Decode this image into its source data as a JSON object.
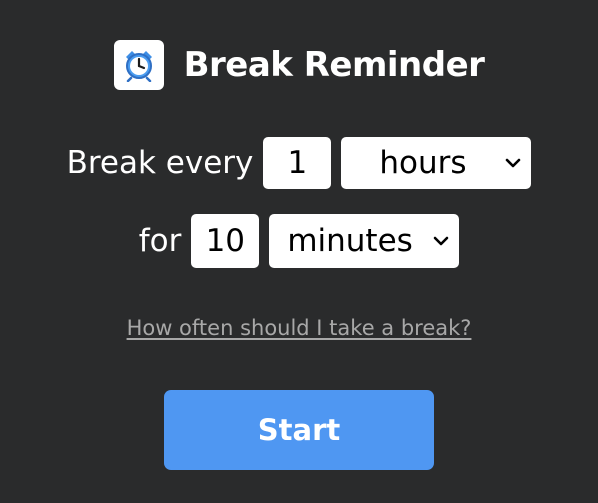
{
  "app": {
    "title": "Break Reminder",
    "icon": "alarm-clock-icon",
    "icon_color": "#3d8ee6"
  },
  "schedule": {
    "break_every_label": "Break every",
    "interval_value": "1",
    "interval_unit": "hours",
    "for_label": "for",
    "duration_value": "10",
    "duration_unit": "minutes"
  },
  "help_link": {
    "label": "How often should I take a break?"
  },
  "start_button": {
    "label": "Start",
    "color": "#4f97f2"
  },
  "theme": {
    "background": "#2a2b2c",
    "text": "#ffffff",
    "link": "#a8a8a8"
  }
}
